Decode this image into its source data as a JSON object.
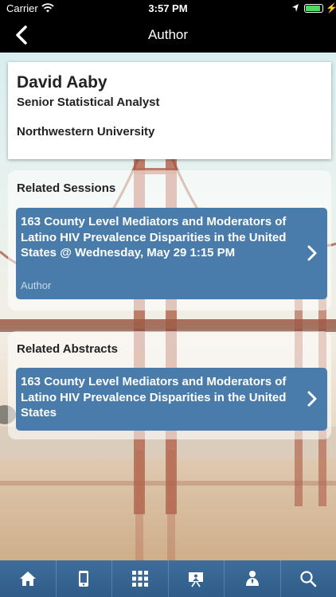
{
  "status_bar": {
    "carrier": "Carrier",
    "time": "3:57 PM",
    "battery_fraction": 0.9
  },
  "nav": {
    "title": "Author",
    "back_icon": "chevron-left-icon"
  },
  "author": {
    "name": "David Aaby",
    "title": "Senior Statistical Analyst",
    "organization": "Northwestern University"
  },
  "sessions": {
    "heading": "Related Sessions",
    "items": [
      {
        "text": "163 County Level Mediators and Moderators of Latino HIV Prevalence Disparities in the United States @ Wednesday, May 29 1:15 PM",
        "role": "Author"
      }
    ]
  },
  "abstracts": {
    "heading": "Related Abstracts",
    "items": [
      {
        "text": "163 County Level Mediators and Moderators of Latino HIV Prevalence Disparities in the United States"
      }
    ]
  },
  "tab_bar": {
    "tabs": [
      "home-icon",
      "mobile-device-icon",
      "grid-icon",
      "presentation-icon",
      "person-icon",
      "search-icon"
    ]
  },
  "colors": {
    "accent": "#4a7cab",
    "tabbar": "#3a6896"
  }
}
